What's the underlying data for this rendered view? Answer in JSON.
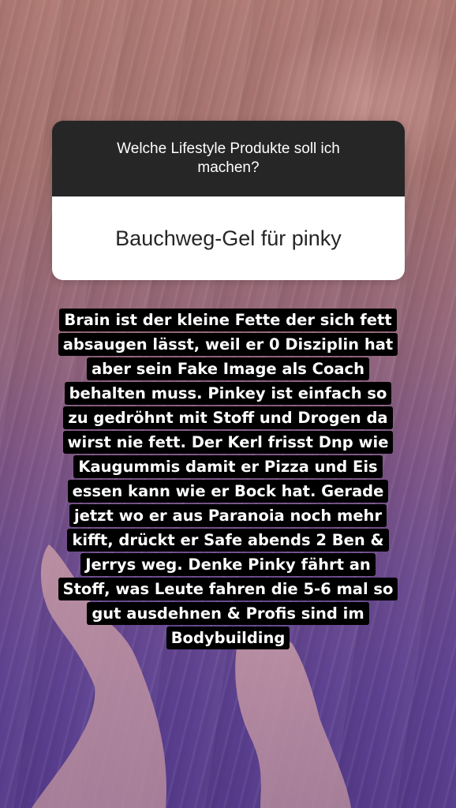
{
  "question_sticker": {
    "question": "Welche Lifestyle Produkte soll ich machen?",
    "answer": "Bauchweg-Gel für pinky"
  },
  "caption": {
    "lines": [
      "Brain ist der kleine Fette der sich fett",
      "absaugen lässt, weil er 0 Disziplin hat",
      "aber sein Fake Image als Coach",
      "behalten muss. Pinkey ist einfach so",
      "zu gedröhnt mit Stoff und Drogen da",
      "wirst nie fett. Der Kerl frisst Dnp wie",
      "Kaugummis damit er Pizza und Eis",
      "essen kann wie er Bock hat. Gerade",
      "jetzt wo er aus Paranoia noch mehr",
      "kifft, drückt er Safe abends 2 Ben &",
      "Jerrys weg. Denke Pinky fährt an",
      "Stoff, was Leute fahren die 5-6 mal so",
      "gut ausdehnen & Profis sind im",
      "Bodybuilding"
    ]
  },
  "colors": {
    "sticker_header": "#262626",
    "sticker_body": "#ffffff",
    "caption_background": "#000000",
    "caption_text": "#ffffff"
  }
}
